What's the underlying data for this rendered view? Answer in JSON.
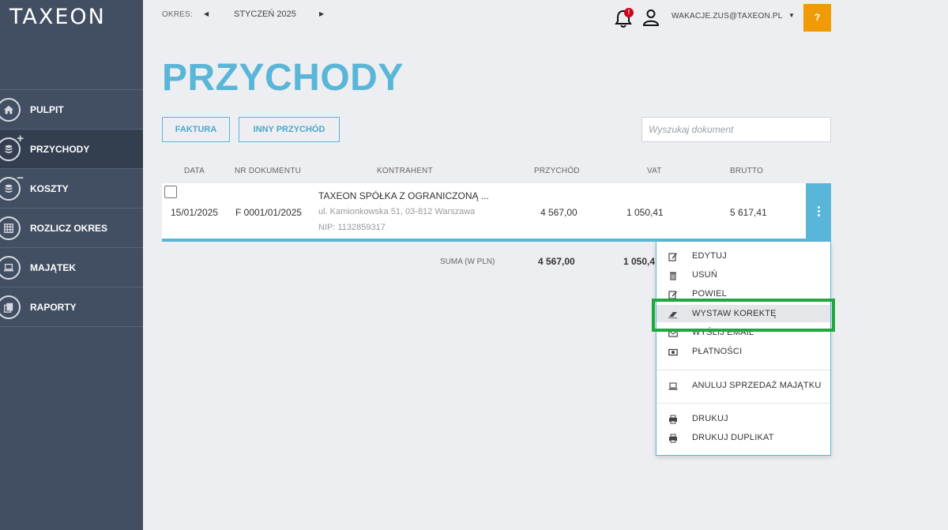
{
  "sidebar": {
    "logo": "TAXEON",
    "items": [
      {
        "label": "PULPIT",
        "icon": "home-icon"
      },
      {
        "label": "PRZYCHODY",
        "icon": "coins-plus-icon"
      },
      {
        "label": "KOSZTY",
        "icon": "coins-minus-icon"
      },
      {
        "label": "ROZLICZ OKRES",
        "icon": "grid-icon"
      },
      {
        "label": "MAJĄTEK",
        "icon": "laptop-icon"
      },
      {
        "label": "RAPORTY",
        "icon": "documents-icon"
      }
    ],
    "active_index": 1
  },
  "topbar": {
    "okres_label": "OKRES:",
    "okres_value": "STYCZEŃ 2025",
    "notification_badge": "!",
    "email": "WAKACJE.ZUS@TAXEON.PL",
    "help_label": "?"
  },
  "page": {
    "title": "PRZYCHODY",
    "btn_faktura": "FAKTURA",
    "btn_inny": "INNY PRZYCHÓD",
    "search_placeholder": "Wyszukaj dokument"
  },
  "table": {
    "headers": [
      "DATA",
      "NR DOKUMENTU",
      "KONTRAHENT",
      "PRZYCHÓD",
      "VAT",
      "BRUTTO"
    ],
    "rows": [
      {
        "data": "15/01/2025",
        "nr": "F 0001/01/2025",
        "kontrahent": "TAXEON SPÓŁKA Z OGRANICZONĄ ...",
        "adres": "ul. Kamionkowska 51, 03-812 Warszawa",
        "nip": "NIP: 1132859317",
        "przychod": "4 567,00",
        "vat": "1 050,41",
        "brutto": "5 617,41"
      }
    ],
    "sum_label": "SUMA (W PLN)",
    "sum_przychod": "4 567,00",
    "sum_vat": "1 050,4"
  },
  "menu": {
    "items": [
      {
        "label": "EDYTUJ",
        "icon": "edit-icon"
      },
      {
        "label": "USUŃ",
        "icon": "trash-icon"
      },
      {
        "label": "POWIEL",
        "icon": "duplicate-icon"
      },
      {
        "label": "WYSTAW KOREKTĘ",
        "icon": "eraser-icon"
      },
      {
        "label": "WYŚLIJ EMAIL",
        "icon": "envelope-icon"
      },
      {
        "label": "PŁATNOŚCI",
        "icon": "money-icon"
      },
      {
        "label": "ANULUJ SPRZEDAŻ MAJĄTKU",
        "icon": "laptop-icon"
      },
      {
        "label": "DRUKUJ",
        "icon": "printer-icon"
      },
      {
        "label": "DRUKUJ DUPLIKAT",
        "icon": "printer-icon"
      }
    ],
    "highlighted_index": 3
  },
  "colors": {
    "sidebar": "#424f62",
    "sidebar_active": "#333e4f",
    "accent": "#5ab6d8",
    "help": "#f09a06",
    "badge": "#d0021b",
    "highlight_box": "#1fa83f"
  }
}
